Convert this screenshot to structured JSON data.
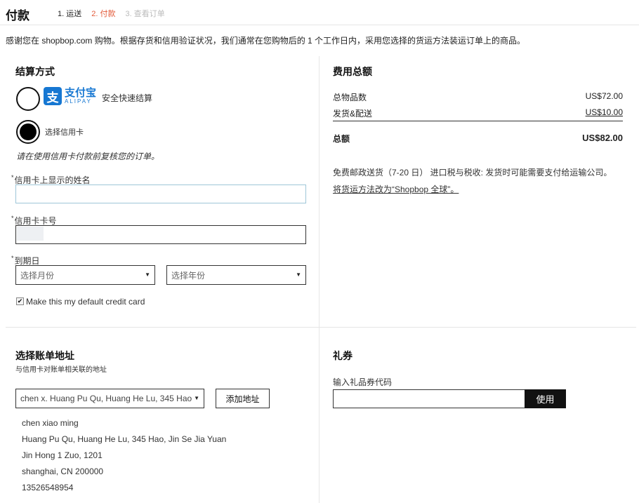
{
  "header": {
    "title": "付款",
    "steps": [
      "1. 运送",
      "2. 付款",
      "3. 查看订单"
    ]
  },
  "notice": "感谢您在 shopbop.com 购物。根据存货和信用验证状况，我们通常在您购物后的 1 个工作日内，采用您选择的货运方法装运订单上的商品。",
  "payment": {
    "title": "结算方式",
    "alipay_cn": "支付宝",
    "alipay_en": "ALIPAY",
    "alipay_caption": "安全快速结算",
    "credit_card_option": "选择信用卡",
    "review_note": "请在使用信用卡付款前复核您的订单。",
    "name_label": "信用卡上显示的姓名",
    "name_value": "",
    "number_label": "信用卡卡号",
    "expiry_label": "到期日",
    "month_placeholder": "选择月份",
    "year_placeholder": "选择年份",
    "default_card_label": "Make this my default credit card",
    "required_mark": "*"
  },
  "summary": {
    "title": "费用总额",
    "items_label": "总物品数",
    "items_value": "US$72.00",
    "shipping_label": "发货&配送",
    "shipping_value": "US$10.00",
    "total_label": "总额",
    "total_value": "US$82.00",
    "shipping_note": "免费邮政送货（7-20 日） 进口税与税收: 发货时可能需要支付给运输公司。",
    "change_link": "将货运方法改为“Shopbop 全球”。"
  },
  "billing": {
    "title": "选择账单地址",
    "subtitle": "与信用卡对账单相关联的地址",
    "selected_address": "chen x. Huang Pu Qu, Huang He Lu, 345 Hao",
    "add_button": "添加地址",
    "address_lines": [
      "chen xiao ming",
      "Huang Pu Qu, Huang He Lu, 345 Hao, Jin Se Jia Yuan",
      "Jin Hong 1 Zuo, 1201",
      "shanghai, CN 200000",
      "13526548954"
    ]
  },
  "gift": {
    "title": "礼券",
    "code_label": "输入礼品券代码",
    "apply_button": "使用"
  }
}
